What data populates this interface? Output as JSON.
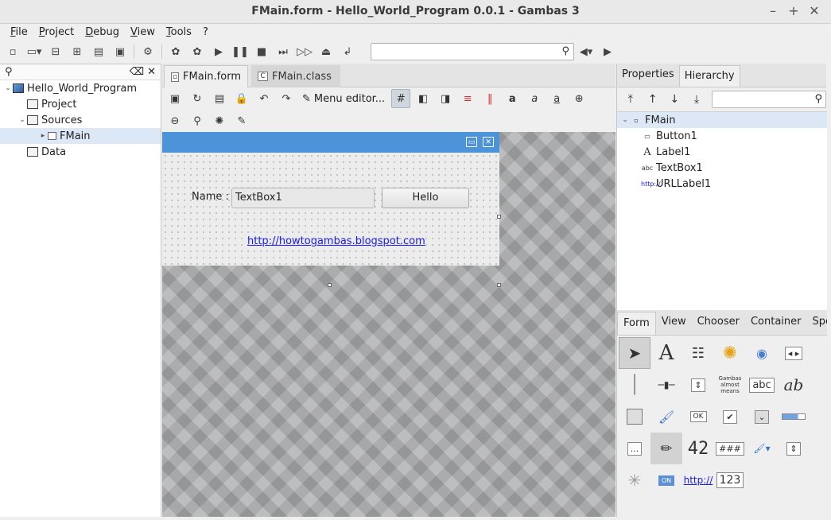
{
  "window": {
    "title": "FMain.form - Hello_World_Program 0.0.1 - Gambas 3"
  },
  "menu": [
    "File",
    "Project",
    "Debug",
    "View",
    "Tools",
    "?"
  ],
  "toolbar": {
    "search_value": ""
  },
  "project_tree": {
    "search_value": "",
    "items": [
      {
        "label": "Hello_World_Program"
      },
      {
        "label": "Project"
      },
      {
        "label": "Sources"
      },
      {
        "label": "FMain"
      },
      {
        "label": "Data"
      }
    ]
  },
  "editor": {
    "tabs": [
      {
        "label": "FMain.form"
      },
      {
        "label": "FMain.class"
      }
    ],
    "menu_editor_label": "Menu editor..."
  },
  "form": {
    "name_label": "Name :",
    "textbox_value": "TextBox1",
    "button_label": "Hello",
    "url_label": "http://howtogambas.blogspot.com"
  },
  "right": {
    "tabs": [
      "Properties",
      "Hierarchy"
    ],
    "hierarchy": {
      "root": "FMain",
      "children": [
        "Button1",
        "Label1",
        "TextBox1",
        "URLLabel1"
      ]
    },
    "toolbox_tabs": [
      "Form",
      "View",
      "Chooser",
      "Container",
      "Spe"
    ],
    "toolbox_text": {
      "label_glyph": "A",
      "ok": "OK",
      "text": "abc",
      "num": "###",
      "lcd": "42",
      "url": "http://",
      "spin": "123",
      "switch": "ON",
      "dots": "...",
      "gambas": "Gambas almost means"
    }
  },
  "colors": {
    "accent": "#4d93d9",
    "link": "#1a1aee",
    "selection": "#dde8f6"
  }
}
